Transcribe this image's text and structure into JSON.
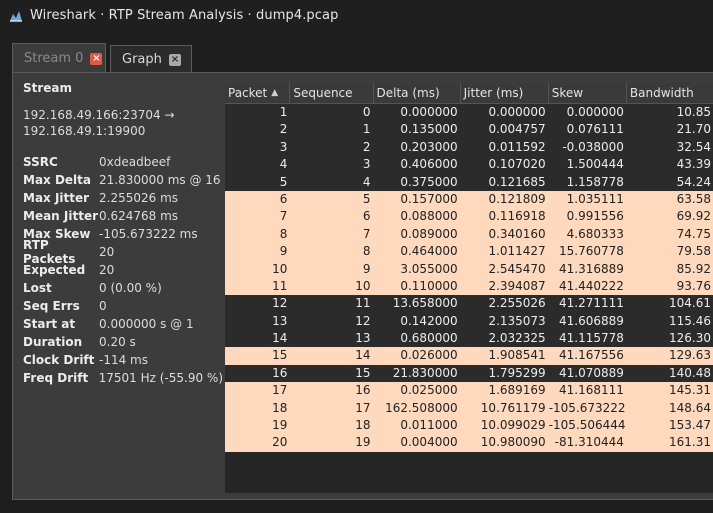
{
  "window": {
    "title": "Wireshark · RTP Stream Analysis · dump4.pcap"
  },
  "tabs": [
    {
      "label": "Stream 0",
      "active": true
    },
    {
      "label": "Graph",
      "active": false
    }
  ],
  "sidebar": {
    "heading": "Stream",
    "address_line1": "192.168.49.166:23704 →",
    "address_line2": "192.168.49.1:19900",
    "stats": [
      {
        "label": "SSRC",
        "value": "0xdeadbeef"
      },
      {
        "label": "Max Delta",
        "value": "21.830000 ms @ 16"
      },
      {
        "label": "Max Jitter",
        "value": "2.255026 ms"
      },
      {
        "label": "Mean Jitter",
        "value": "0.624768 ms"
      },
      {
        "label": "Max Skew",
        "value": "-105.673222 ms"
      },
      {
        "label": "RTP Packets",
        "value": "20"
      },
      {
        "label": "Expected",
        "value": "20"
      },
      {
        "label": "Lost",
        "value": "0 (0.00 %)"
      },
      {
        "label": "Seq Errs",
        "value": "0"
      },
      {
        "label": "Start at",
        "value": "0.000000 s @ 1"
      },
      {
        "label": "Duration",
        "value": "0.20 s"
      },
      {
        "label": "Clock Drift",
        "value": "-114 ms"
      },
      {
        "label": "Freq Drift",
        "value": "17501 Hz (-55.90 %)"
      }
    ]
  },
  "table": {
    "columns": [
      "Packet",
      "Sequence",
      "Delta (ms)",
      "Jitter (ms)",
      "Skew",
      "Bandwidth"
    ],
    "rows": [
      {
        "packet": "1",
        "seq": "0",
        "delta": "0.000000",
        "jitter": "0.000000",
        "skew": "0.000000",
        "bw": "10.85",
        "highlight": false
      },
      {
        "packet": "2",
        "seq": "1",
        "delta": "0.135000",
        "jitter": "0.004757",
        "skew": "0.076111",
        "bw": "21.70",
        "highlight": false
      },
      {
        "packet": "3",
        "seq": "2",
        "delta": "0.203000",
        "jitter": "0.011592",
        "skew": "-0.038000",
        "bw": "32.54",
        "highlight": false
      },
      {
        "packet": "4",
        "seq": "3",
        "delta": "0.406000",
        "jitter": "0.107020",
        "skew": "1.500444",
        "bw": "43.39",
        "highlight": false
      },
      {
        "packet": "5",
        "seq": "4",
        "delta": "0.375000",
        "jitter": "0.121685",
        "skew": "1.158778",
        "bw": "54.24",
        "highlight": false
      },
      {
        "packet": "6",
        "seq": "5",
        "delta": "0.157000",
        "jitter": "0.121809",
        "skew": "1.035111",
        "bw": "63.58",
        "highlight": true
      },
      {
        "packet": "7",
        "seq": "6",
        "delta": "0.088000",
        "jitter": "0.116918",
        "skew": "0.991556",
        "bw": "69.92",
        "highlight": true
      },
      {
        "packet": "8",
        "seq": "7",
        "delta": "0.089000",
        "jitter": "0.340160",
        "skew": "4.680333",
        "bw": "74.75",
        "highlight": true
      },
      {
        "packet": "9",
        "seq": "8",
        "delta": "0.464000",
        "jitter": "1.011427",
        "skew": "15.760778",
        "bw": "79.58",
        "highlight": true
      },
      {
        "packet": "10",
        "seq": "9",
        "delta": "3.055000",
        "jitter": "2.545470",
        "skew": "41.316889",
        "bw": "85.92",
        "highlight": true
      },
      {
        "packet": "11",
        "seq": "10",
        "delta": "0.110000",
        "jitter": "2.394087",
        "skew": "41.440222",
        "bw": "93.76",
        "highlight": true
      },
      {
        "packet": "12",
        "seq": "11",
        "delta": "13.658000",
        "jitter": "2.255026",
        "skew": "41.271111",
        "bw": "104.61",
        "highlight": false
      },
      {
        "packet": "13",
        "seq": "12",
        "delta": "0.142000",
        "jitter": "2.135073",
        "skew": "41.606889",
        "bw": "115.46",
        "highlight": false
      },
      {
        "packet": "14",
        "seq": "13",
        "delta": "0.680000",
        "jitter": "2.032325",
        "skew": "41.115778",
        "bw": "126.30",
        "highlight": false
      },
      {
        "packet": "15",
        "seq": "14",
        "delta": "0.026000",
        "jitter": "1.908541",
        "skew": "41.167556",
        "bw": "129.63",
        "highlight": true
      },
      {
        "packet": "16",
        "seq": "15",
        "delta": "21.830000",
        "jitter": "1.795299",
        "skew": "41.070889",
        "bw": "140.48",
        "highlight": false
      },
      {
        "packet": "17",
        "seq": "16",
        "delta": "0.025000",
        "jitter": "1.689169",
        "skew": "41.168111",
        "bw": "145.31",
        "highlight": true
      },
      {
        "packet": "18",
        "seq": "17",
        "delta": "162.508000",
        "jitter": "10.761179",
        "skew": "-105.673222",
        "bw": "148.64",
        "highlight": true
      },
      {
        "packet": "19",
        "seq": "18",
        "delta": "0.011000",
        "jitter": "10.099029",
        "skew": "-105.506444",
        "bw": "153.47",
        "highlight": true
      },
      {
        "packet": "20",
        "seq": "19",
        "delta": "0.004000",
        "jitter": "10.980090",
        "skew": "-81.310444",
        "bw": "161.31",
        "highlight": true
      }
    ]
  },
  "colors": {
    "highlight_row": "#fed9be",
    "normal_row": "#2b2b2b",
    "close_active": "#e05a43"
  },
  "icons": {
    "app": "wireshark-fin-icon",
    "tab_close": "close-icon",
    "sort": "sort-ascending-icon"
  }
}
